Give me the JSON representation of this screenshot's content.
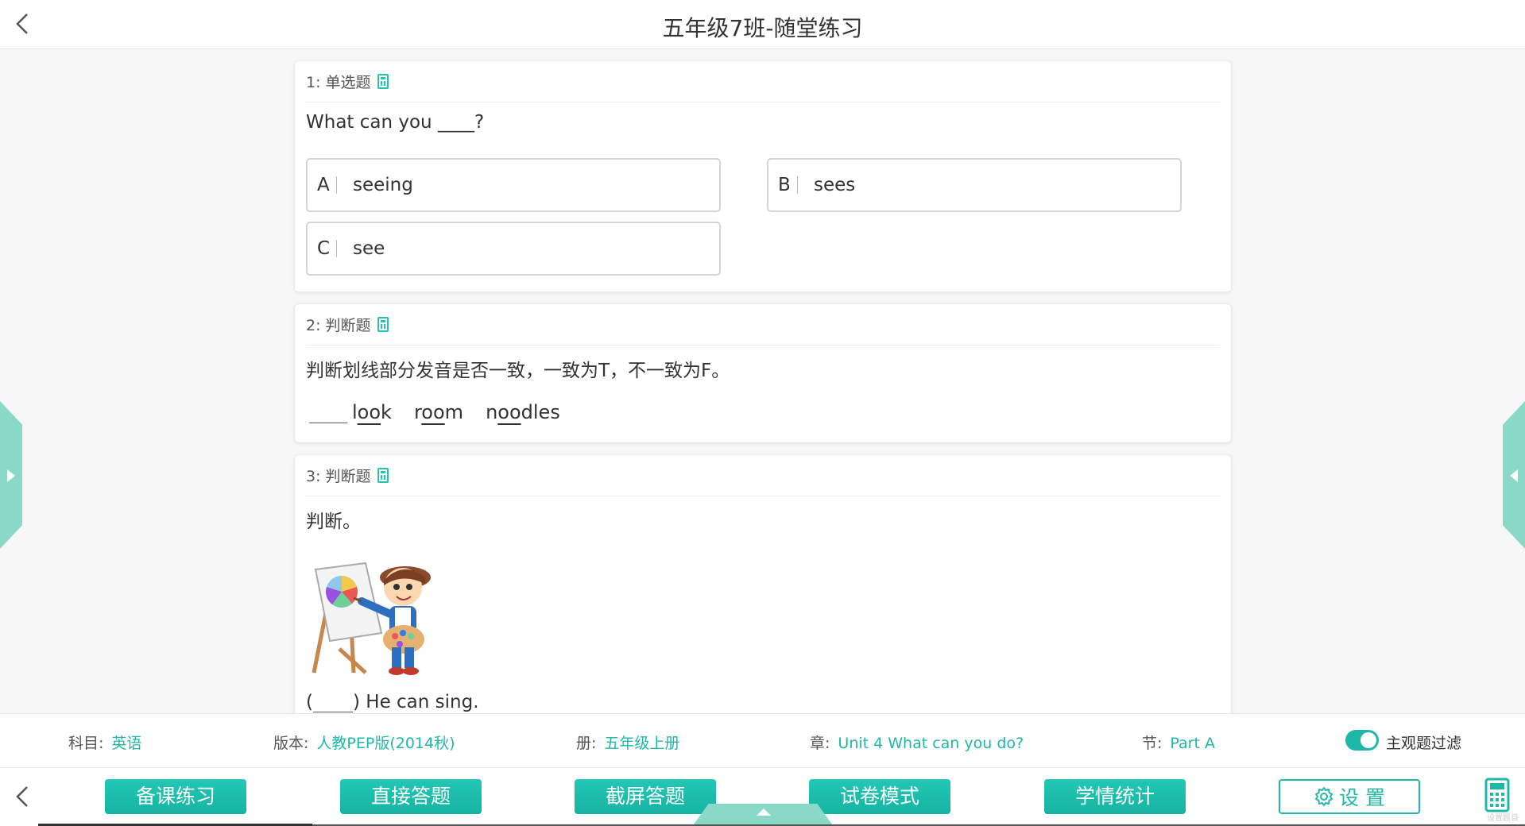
{
  "header": {
    "title": "五年级7班-随堂练习"
  },
  "questions": [
    {
      "number_type": "1: 单选题",
      "text": "What can you ____?",
      "options": [
        {
          "letter": "A",
          "text": "seeing"
        },
        {
          "letter": "B",
          "text": "sees"
        },
        {
          "letter": "C",
          "text": "see"
        }
      ]
    },
    {
      "number_type": "2: 判断题",
      "text": "判断划线部分发音是否一致，一致为T，不一致为F。",
      "words": [
        {
          "pre": "l",
          "u": "oo",
          "post": "k"
        },
        {
          "pre": "r",
          "u": "oo",
          "post": "m"
        },
        {
          "pre": "n",
          "u": "oo",
          "post": "dles"
        }
      ]
    },
    {
      "number_type": "3: 判断题",
      "text": "判断。",
      "answer_pre": "(",
      "answer_post": ") He can sing."
    }
  ],
  "info": {
    "subject_label": "科目:",
    "subject": "英语",
    "edition_label": "版本:",
    "edition": "人教PEP版(2014秋)",
    "volume_label": "册:",
    "volume": "五年级上册",
    "chapter_label": "章:",
    "chapter": "Unit 4 What can you do?",
    "section_label": "节:",
    "section": "Part A",
    "filter_label": "主观题过滤"
  },
  "toolbar": {
    "buttons": [
      "备课练习",
      "直接答题",
      "截屏答题",
      "试卷模式",
      "学情统计"
    ],
    "settings": "设 置",
    "watermark": "设置题目"
  },
  "colors": {
    "accent": "#1fb8a8",
    "side_tab": "#8ad8c8"
  }
}
